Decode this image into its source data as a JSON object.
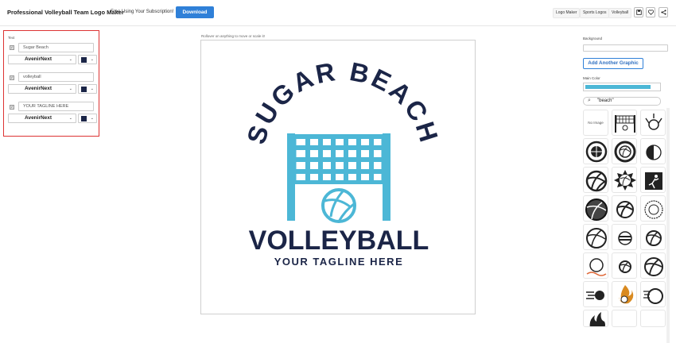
{
  "header": {
    "title": "Professional Volleyball Team Logo Maker",
    "subscription_text": "Free Using Your Subscription!",
    "download_label": "Download",
    "nav_links": [
      "Logo Maker",
      "Sports Logos",
      "Volleyball"
    ],
    "icon_buttons": [
      "save-icon",
      "heart-icon",
      "share-icon"
    ]
  },
  "text_panel": {
    "label": "Text",
    "rows": [
      {
        "value": "Sugar Beach",
        "font": "AvenirNext",
        "color": "#1b2547"
      },
      {
        "value": "volleyball",
        "font": "AvenirNext",
        "color": "#1b2547"
      },
      {
        "value": "YOUR TAGLINE HERE",
        "font": "AvenirNext",
        "color": "#1b2547"
      }
    ]
  },
  "canvas": {
    "hint": "Rollover on anything to move or scale it!",
    "logo": {
      "arc_text": "SUGAR BEACH",
      "main_text": "VOLLEYBALL",
      "tagline": "YOUR TAGLINE HERE",
      "navy": "#1b2547",
      "blue": "#4cb7d6"
    }
  },
  "right_panel": {
    "background_label": "Background",
    "add_graphic_label": "Add Another Graphic",
    "main_color_label": "Main Color",
    "main_color": "#4cb7d6",
    "search_value": "\"beach\"",
    "no_image_label": "No Image"
  }
}
